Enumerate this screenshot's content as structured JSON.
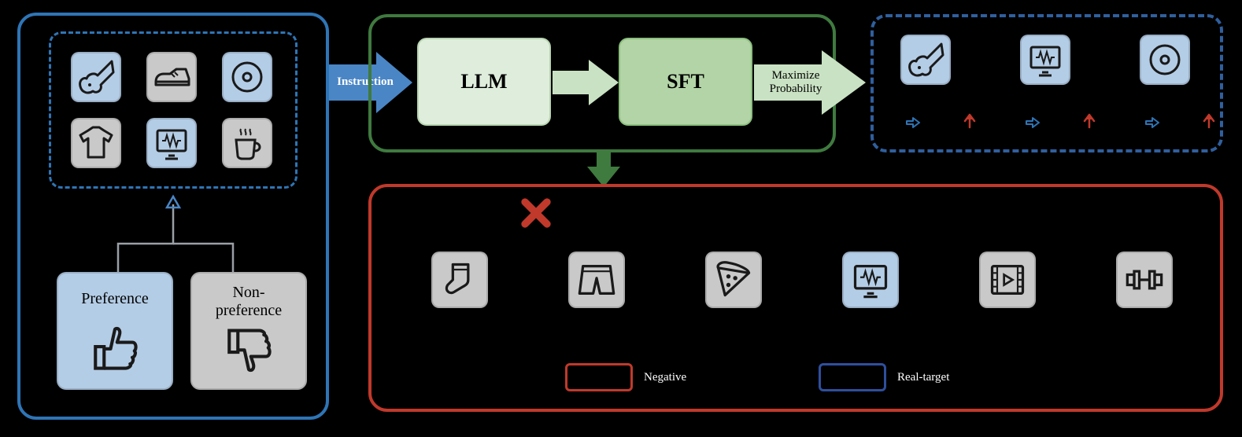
{
  "left_panel": {
    "history_items": [
      {
        "name": "guitar-icon",
        "pref": true
      },
      {
        "name": "sneaker-icon",
        "pref": false
      },
      {
        "name": "disc-icon",
        "pref": true
      },
      {
        "name": "tshirt-icon",
        "pref": false
      },
      {
        "name": "tv-audio-icon",
        "pref": true
      },
      {
        "name": "coffee-icon",
        "pref": false
      }
    ],
    "pref_label": "Preference",
    "nonpref_label_line1": "Non-",
    "nonpref_label_line2": "preference"
  },
  "middle": {
    "instruction_label": "Instruction",
    "llm_label": "LLM",
    "sft_label": "SFT",
    "max_prob_line1": "Maximize",
    "max_prob_line2": "Probability"
  },
  "right_panel": {
    "items": [
      {
        "name": "guitar-icon"
      },
      {
        "name": "tv-audio-icon"
      },
      {
        "name": "disc-icon"
      }
    ]
  },
  "bottom_panel": {
    "items": [
      {
        "name": "sock-icon",
        "pref": false
      },
      {
        "name": "shorts-icon",
        "pref": false
      },
      {
        "name": "pizza-icon",
        "pref": false
      },
      {
        "name": "tv-audio-icon",
        "pref": true
      },
      {
        "name": "movie-icon",
        "pref": false
      },
      {
        "name": "dumbbell-icon",
        "pref": false
      }
    ],
    "legend_neg": "Negative",
    "legend_pos": "Real-target"
  }
}
